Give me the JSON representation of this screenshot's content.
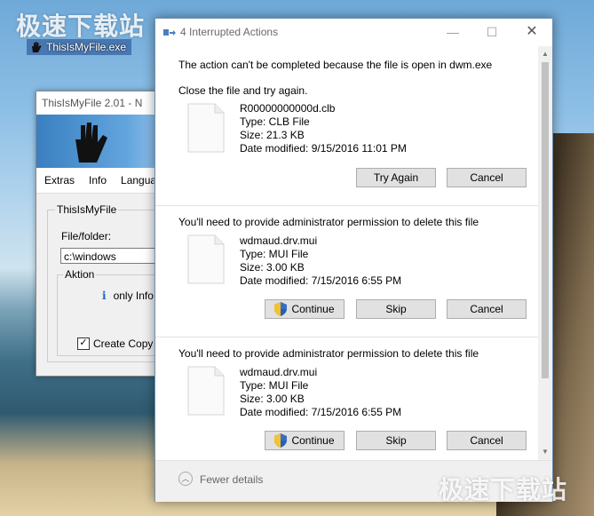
{
  "watermark": {
    "top": "极速下载站",
    "bottom": "极速下载站"
  },
  "desktop_icon": {
    "label": "ThisIsMyFile.exe"
  },
  "app": {
    "title": "ThisIsMyFile 2.01 - N",
    "banner_mark": "1",
    "menu": [
      "Extras",
      "Info",
      "Language"
    ],
    "group_label": "ThisIsMyFile",
    "field_label": "File/folder:",
    "field_value": "c:\\windows",
    "aktion_label": "Aktion",
    "info_text": "only Info",
    "create_copy": "Create Copy"
  },
  "dialog": {
    "title": "4 Interrupted Actions",
    "sections": [
      {
        "messages": [
          "The action can't be completed because the file is open in dwm.exe",
          "Close the file and try again."
        ],
        "file": {
          "name": "R00000000000d.clb",
          "type": "Type: CLB File",
          "size": "Size: 21.3 KB",
          "date": "Date modified: 9/15/2016 11:01 PM"
        },
        "buttons": [
          "Try Again",
          "Cancel"
        ]
      },
      {
        "messages": [
          "You'll need to provide administrator permission to delete this file"
        ],
        "file": {
          "name": "wdmaud.drv.mui",
          "type": "Type: MUI File",
          "size": "Size: 3.00 KB",
          "date": "Date modified: 7/15/2016 6:55 PM"
        },
        "buttons": [
          "Continue",
          "Skip",
          "Cancel"
        ]
      },
      {
        "messages": [
          "You'll need to provide administrator permission to delete this file"
        ],
        "file": {
          "name": "wdmaud.drv.mui",
          "type": "Type: MUI File",
          "size": "Size: 3.00 KB",
          "date": "Date modified: 7/15/2016 6:55 PM"
        },
        "buttons": [
          "Continue",
          "Skip",
          "Cancel"
        ]
      }
    ],
    "footer": "Fewer details"
  }
}
